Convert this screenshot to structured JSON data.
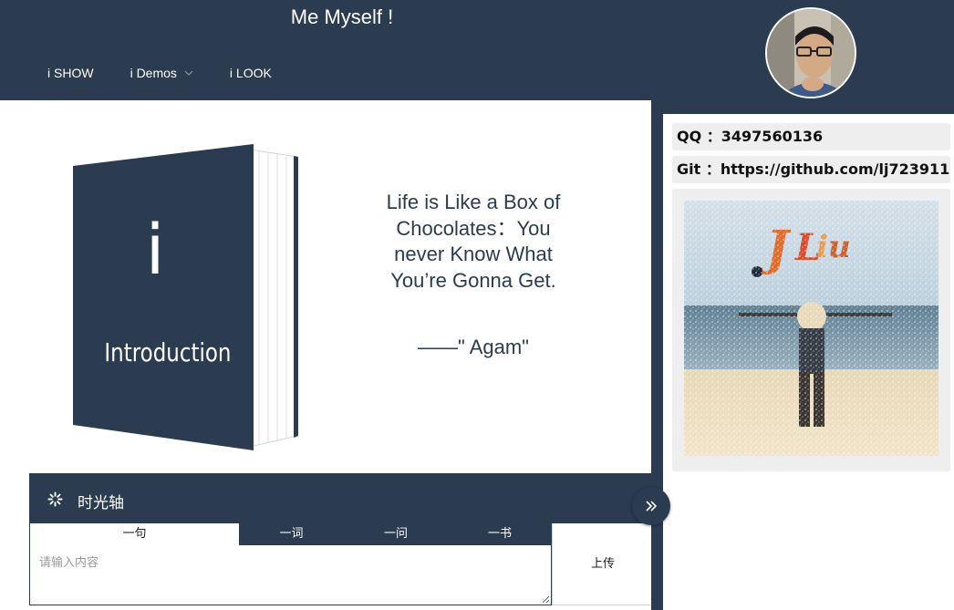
{
  "header": {
    "title": "Me Myself !",
    "nav": [
      {
        "label": "i SHOW"
      },
      {
        "label": "i Demos"
      },
      {
        "label": "i LOOK"
      }
    ]
  },
  "book": {
    "letter": "i",
    "subtitle": "Introduction"
  },
  "quote": {
    "text": "Life is Like a Box of Chocolates：You never Know What You’re Gonna Get.",
    "author": "——\" Agam\""
  },
  "timeline": {
    "title": "时光轴",
    "tabs": [
      {
        "label": "一句"
      },
      {
        "label": "一词"
      },
      {
        "label": "一问"
      },
      {
        "label": "一书"
      }
    ],
    "active_tab": 0,
    "input_placeholder": "请输入内容",
    "input_value": "",
    "upload_label": "上传"
  },
  "sidebar": {
    "qq": "QQ ：3497560136",
    "git": "Git ：https://github.com/lj723911"
  },
  "colors": {
    "primary": "#2b3c50",
    "panel": "#eeeeee"
  },
  "icons": {
    "nav_dropdown": "chevron-down-icon",
    "timeline": "spinner-icon",
    "toggle": "double-chevron-right-icon"
  }
}
